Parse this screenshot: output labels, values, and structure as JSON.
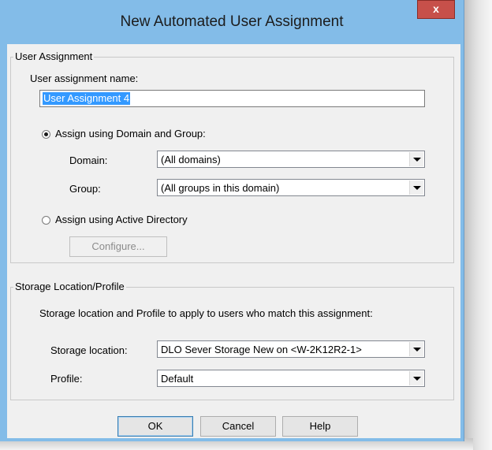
{
  "window": {
    "title": "New Automated User Assignment",
    "close_glyph": "x"
  },
  "user_assignment": {
    "group_label": "User Assignment",
    "name_label": "User assignment name:",
    "name_value": "User Assignment 4",
    "radio_domain_label": "Assign using Domain and Group:",
    "radio_domain_selected": true,
    "domain_label": "Domain:",
    "domain_value": "(All domains)",
    "group_field_label": "Group:",
    "group_value": "(All groups in this domain)",
    "radio_ad_label": "Assign using Active Directory",
    "radio_ad_selected": false,
    "configure_label": "Configure..."
  },
  "storage": {
    "group_label": "Storage Location/Profile",
    "description": "Storage location and Profile to apply to users who match this assignment:",
    "location_label": "Storage location:",
    "location_value": "DLO Sever Storage New on <W-2K12R2-1>",
    "profile_label": "Profile:",
    "profile_value": "Default"
  },
  "buttons": {
    "ok": "OK",
    "cancel": "Cancel",
    "help": "Help"
  },
  "icons": {
    "close": "close-icon",
    "dropdown": "chevron-down-icon"
  },
  "colors": {
    "title_bar": "#83bce8",
    "close_button": "#c7504a",
    "selection": "#3399ff"
  }
}
